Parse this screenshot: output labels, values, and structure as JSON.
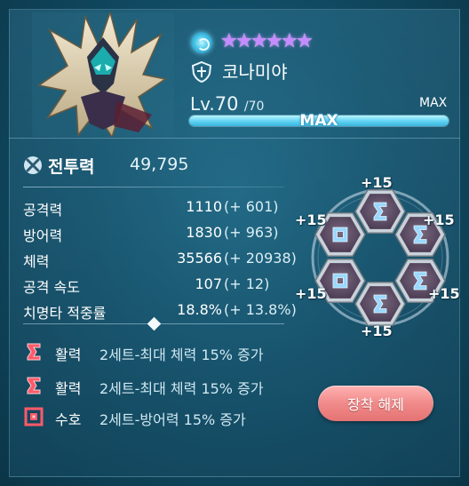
{
  "hero": {
    "name": "코나미야",
    "stars": 6,
    "level_prefix": "Lv.",
    "level": "70",
    "level_max": "/70",
    "max_label": "MAX",
    "exp_text": "MAX",
    "exp_progress": 1.0,
    "element_icon": "water-swirl-icon",
    "class_icon": "shield-cross-icon"
  },
  "combat_power": {
    "label": "전투력",
    "value": "49,795"
  },
  "stats": [
    {
      "name": "공격력",
      "base": "1110",
      "bonus": "(+ 601)"
    },
    {
      "name": "방어력",
      "base": "1830",
      "bonus": "(+ 963)"
    },
    {
      "name": "체력",
      "base": "35566",
      "bonus": "(+ 20938)"
    },
    {
      "name": "공격 속도",
      "base": "107",
      "bonus": "(+ 12)"
    },
    {
      "name": "치명타 적중률",
      "base": "18.8%",
      "bonus": "(+ 13.8%)"
    }
  ],
  "set_effects": [
    {
      "name": "활력",
      "desc": "2세트-최대 체력 15% 증가",
      "icon": "vitality-sigma-icon"
    },
    {
      "name": "활력",
      "desc": "2세트-최대 체력 15% 증가",
      "icon": "vitality-sigma-icon"
    },
    {
      "name": "수호",
      "desc": "2세트-방어력 15% 증가",
      "icon": "guard-square-icon"
    }
  ],
  "equipment": [
    {
      "slot": "top",
      "plus": "+15",
      "rune": "sigma"
    },
    {
      "slot": "upper-right",
      "plus": "+15",
      "rune": "sigma"
    },
    {
      "slot": "lower-right",
      "plus": "+15",
      "rune": "sigma"
    },
    {
      "slot": "bottom",
      "plus": "+15",
      "rune": "sigma"
    },
    {
      "slot": "lower-left",
      "plus": "+15",
      "rune": "square"
    },
    {
      "slot": "upper-left",
      "plus": "+15",
      "rune": "square"
    }
  ],
  "buttons": {
    "unequip": "장착 해제"
  },
  "colors": {
    "star": "#c58bff",
    "exp_bar": "#5fd2f2",
    "unequip_button": "#f08a8a",
    "vitality_icon": "#ff5a6a",
    "guard_icon": "#ff5a6a",
    "rune_glow": "#9ad8ff"
  }
}
